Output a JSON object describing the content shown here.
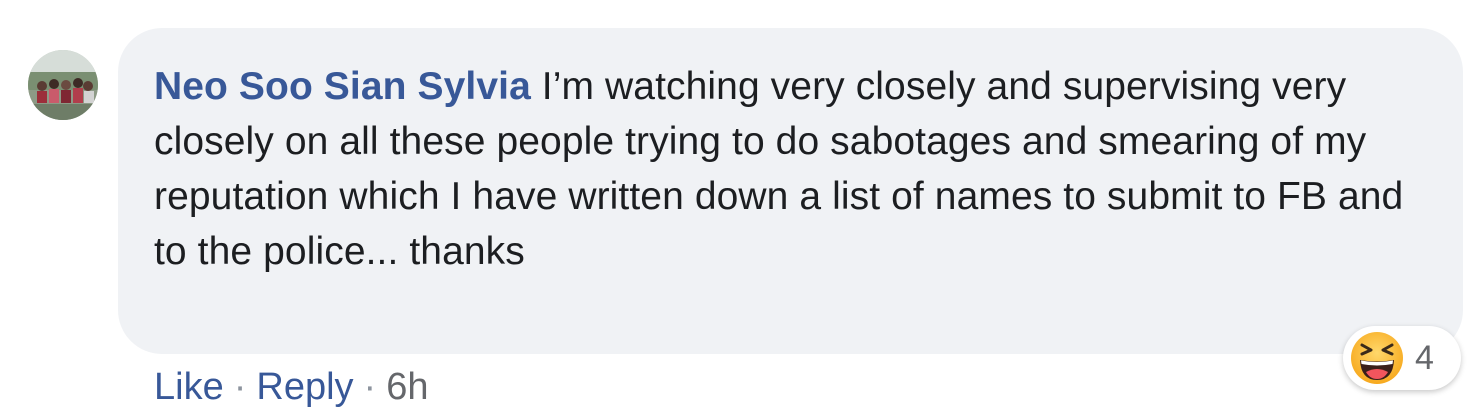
{
  "comment": {
    "author": "Neo Soo Sian Sylvia",
    "text": "I’m watching very closely and supervising very closely on all these people trying to do sabotages and smearing of my reputation which I have written down a list of names to submit to FB and to the police... thanks",
    "avatar_icon": "profile-photo",
    "reactions": {
      "icon": "laughing-face-emoji",
      "count": "4"
    },
    "actions": {
      "like": "Like",
      "separator": "·",
      "reply": "Reply",
      "time": "6h"
    }
  },
  "colors": {
    "author_name": "#385898",
    "bubble_bg": "#f0f2f5",
    "text": "#1c1e21",
    "meta": "#65676b"
  }
}
